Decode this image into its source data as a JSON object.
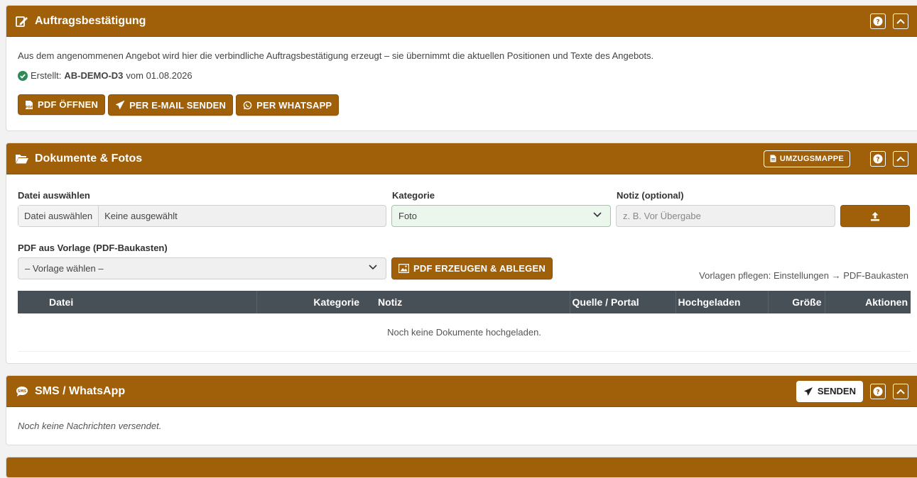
{
  "order": {
    "title": "Auftragsbestätigung",
    "description": "Aus dem angenommenen Angebot wird hier die verbindliche Auftragsbestätigung erzeugt – sie übernimmt die aktuellen Positionen und Texte des Angebots.",
    "status_prefix": "Erstellt:",
    "doc_number": "AB-DEMO-D3",
    "status_suffix": "vom 01.08.2026",
    "btn_pdf": "PDF ÖFFNEN",
    "btn_email": "PER E-MAIL SENDEN",
    "btn_whatsapp": "PER WHATSAPP"
  },
  "docs": {
    "title": "Dokumente & Fotos",
    "btn_umzugsmappe": "UMZUGSMAPPE",
    "file_label": "Datei auswählen",
    "file_button": "Datei auswählen",
    "file_value": "Keine ausgewählt",
    "category_label": "Kategorie",
    "category_value": "Foto",
    "note_label": "Notiz (optional)",
    "note_placeholder": "z. B. Vor Übergabe",
    "template_label": "PDF aus Vorlage (PDF-Baukasten)",
    "template_value": "– Vorlage wählen –",
    "btn_generate": "PDF ERZEUGEN & ABLEGEN",
    "template_hint": "Vorlagen pflegen: Einstellungen → PDF-Baukasten",
    "table_headers": [
      "Datei",
      "Kategorie",
      "Notiz",
      "Quelle / Portal",
      "Hochgeladen",
      "Größe",
      "Aktionen"
    ],
    "empty_text": "Noch keine Dokumente hochgeladen."
  },
  "sms": {
    "title": "SMS / WhatsApp",
    "btn_send": "SENDEN",
    "empty_text": "Noch keine Nachrichten versendet."
  },
  "colors": {
    "header": "#a0600a",
    "table_header": "#474f57",
    "success": "#2e8b57"
  },
  "icons": [
    "edit-icon",
    "help-icon",
    "chevron-up-icon",
    "pdf-file-icon",
    "paper-plane-icon",
    "whatsapp-icon",
    "folder-open-icon",
    "file-icon",
    "chevron-down-icon",
    "upload-icon",
    "image-icon",
    "sms-icon",
    "check-circle-icon"
  ]
}
